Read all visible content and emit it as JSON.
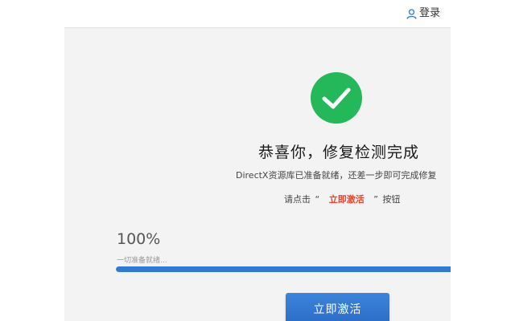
{
  "header": {
    "login_label": "登录",
    "login_icon": "user-icon"
  },
  "result": {
    "status_icon": "check-circle-icon",
    "headline": "恭喜你，修复检测完成",
    "subline": "DirectX资源库已准备就绪，还差一步即可完成修复",
    "instruction_prefix": "请点击",
    "open_quote": "“",
    "instruction_highlight": "立即激活",
    "close_quote": "”",
    "instruction_suffix": "按钮"
  },
  "progress": {
    "percent_label": "100%",
    "value": 100,
    "status_text": "一切准备就绪..."
  },
  "action": {
    "activate_label": "立即激活"
  },
  "colors": {
    "accent": "#2f7ad9",
    "success": "#23b85a",
    "highlight": "#e8452c",
    "panel_bg": "#f3f3f3"
  }
}
